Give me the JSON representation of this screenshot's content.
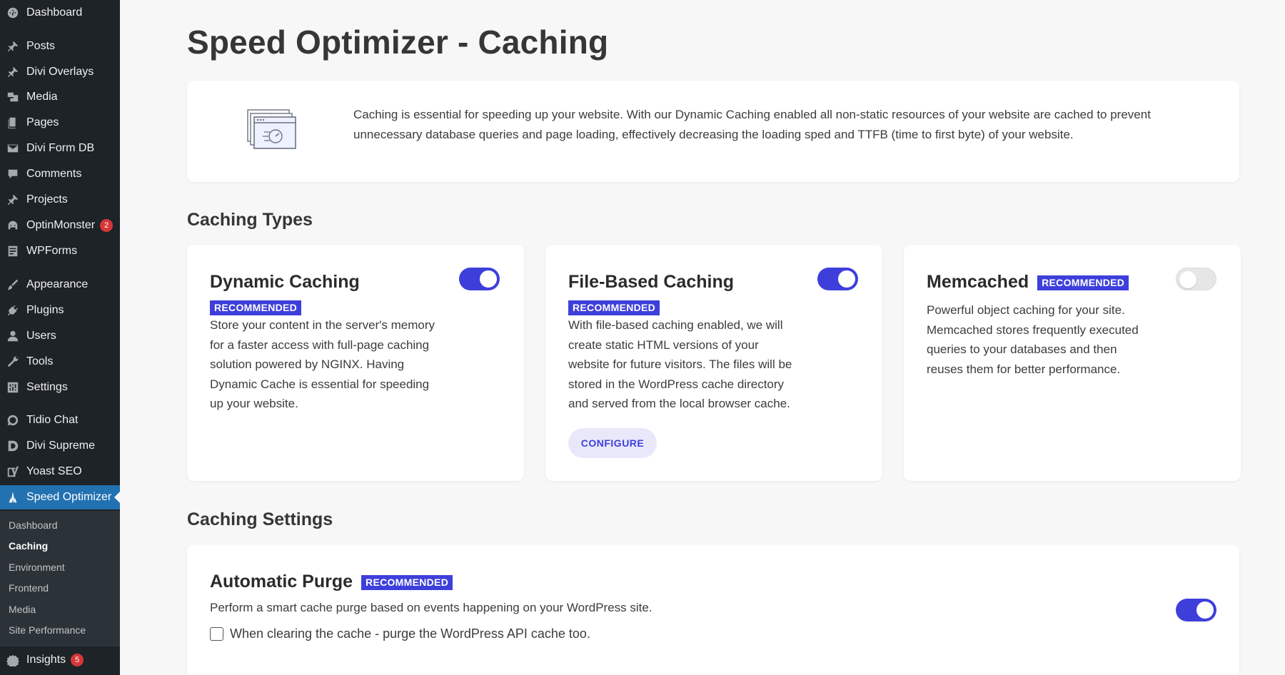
{
  "sidebar": {
    "items": [
      {
        "label": "Dashboard",
        "icon": "dashboard-icon",
        "badge": ""
      },
      {
        "label": "Posts",
        "icon": "pin-icon",
        "badge": ""
      },
      {
        "label": "Divi Overlays",
        "icon": "pin-icon",
        "badge": ""
      },
      {
        "label": "Media",
        "icon": "media-icon",
        "badge": ""
      },
      {
        "label": "Pages",
        "icon": "pages-icon",
        "badge": ""
      },
      {
        "label": "Divi Form DB",
        "icon": "mail-icon",
        "badge": ""
      },
      {
        "label": "Comments",
        "icon": "comment-icon",
        "badge": ""
      },
      {
        "label": "Projects",
        "icon": "pin-icon",
        "badge": ""
      },
      {
        "label": "OptinMonster",
        "icon": "optinmonster-icon",
        "badge": "2"
      },
      {
        "label": "WPForms",
        "icon": "forms-icon",
        "badge": ""
      },
      {
        "label": "Appearance",
        "icon": "brush-icon",
        "badge": ""
      },
      {
        "label": "Plugins",
        "icon": "plug-icon",
        "badge": ""
      },
      {
        "label": "Users",
        "icon": "user-icon",
        "badge": ""
      },
      {
        "label": "Tools",
        "icon": "wrench-icon",
        "badge": ""
      },
      {
        "label": "Settings",
        "icon": "settings-icon",
        "badge": ""
      },
      {
        "label": "Tidio Chat",
        "icon": "chat-icon",
        "badge": ""
      },
      {
        "label": "Divi Supreme",
        "icon": "divi-icon",
        "badge": ""
      },
      {
        "label": "Yoast SEO",
        "icon": "yoast-icon",
        "badge": ""
      },
      {
        "label": "Speed Optimizer",
        "icon": "speed-optimizer-icon",
        "badge": ""
      },
      {
        "label": "Insights",
        "icon": "insights-icon",
        "badge": "5"
      }
    ],
    "submenu": [
      "Dashboard",
      "Caching",
      "Environment",
      "Frontend",
      "Media",
      "Site Performance"
    ],
    "active_item": "Speed Optimizer",
    "current_sub": "Caching"
  },
  "page": {
    "title": "Speed Optimizer - Caching",
    "intro": "Caching is essential for speeding up your website. With our Dynamic Caching enabled all non-static resources of your website are cached to prevent unnecessary database queries and page loading, effectively decreasing the loading sped and TTFB (time to first byte) of your website."
  },
  "caching_types": {
    "section_title": "Caching Types",
    "cards": [
      {
        "title": "Dynamic Caching",
        "badge": "RECOMMENDED",
        "enabled": true,
        "description": "Store your content in the server's memory for a faster access with full-page caching solution powered by NGINX. Having Dynamic Cache is essential for speeding up your website."
      },
      {
        "title": "File-Based Caching",
        "badge": "RECOMMENDED",
        "enabled": true,
        "description": "With file-based caching enabled, we will create static HTML versions of your website for future visitors. The files will be stored in the WordPress cache directory and served from the local browser cache.",
        "button": "CONFIGURE"
      },
      {
        "title": "Memcached",
        "badge": "RECOMMENDED",
        "enabled": false,
        "description": "Powerful object caching for your site. Memcached stores frequently executed queries to your databases and then reuses them for better performance."
      }
    ]
  },
  "caching_settings": {
    "section_title": "Caching Settings",
    "automatic_purge": {
      "title": "Automatic Purge",
      "badge": "RECOMMENDED",
      "enabled": true,
      "description": "Perform a smart cache purge based on events happening on your WordPress site.",
      "checkbox_label": "When clearing the cache - purge the WordPress API cache too.",
      "checkbox_checked": false
    }
  },
  "colors": {
    "accent": "#3e3fdb",
    "sidebar_bg": "#1d2327",
    "active_bg": "#2271b1",
    "badge_red": "#d63638"
  }
}
